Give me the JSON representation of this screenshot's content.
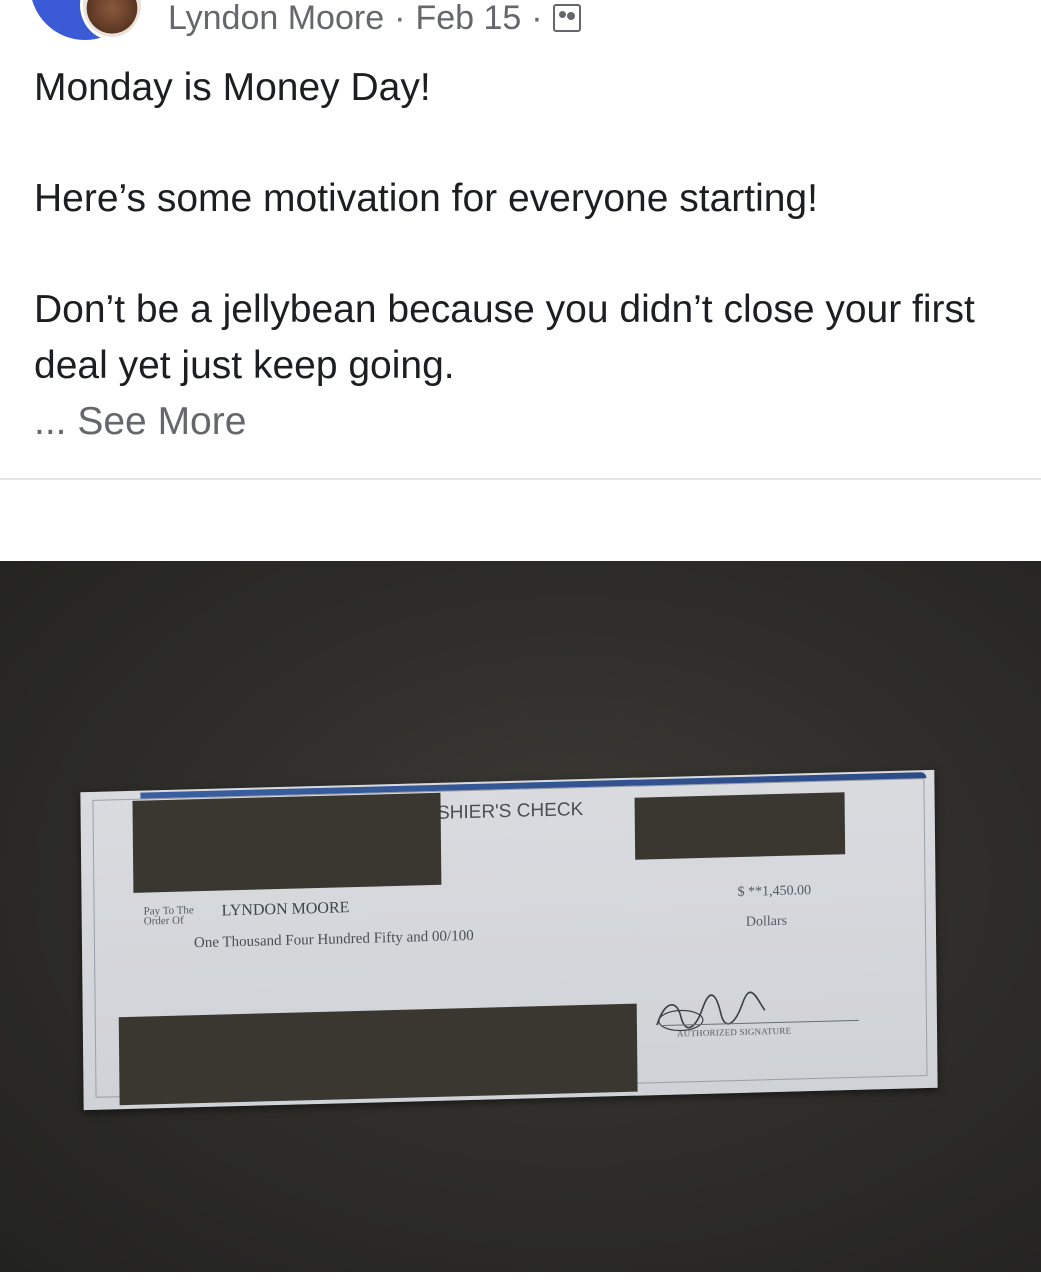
{
  "post": {
    "author": "Lyndon Moore",
    "separator": "·",
    "date": "Feb 15",
    "separator2": "·",
    "privacy_icon": "photo-album-icon",
    "line1": "Monday is Money Day!",
    "line2": "Here’s some motivation for everyone starting!",
    "line3": "Don’t be a jellybean because you didn’t close your first deal yet just keep going.",
    "see_more": "... See More"
  },
  "check": {
    "title": "CASHIER'S CHECK",
    "pay_to_label": "Pay To The Order Of",
    "payee": "LYNDON MOORE",
    "amount": "$ **1,450.00",
    "amount_words": "One Thousand Four Hundred Fifty and 00/100",
    "dollars_label": "Dollars",
    "signature_label": "AUTHORIZED SIGNATURE"
  },
  "colors": {
    "text": "#1c1e21",
    "meta": "#65676b",
    "avatar_ring": "#3b5bd6",
    "redaction": "#3a3731"
  }
}
